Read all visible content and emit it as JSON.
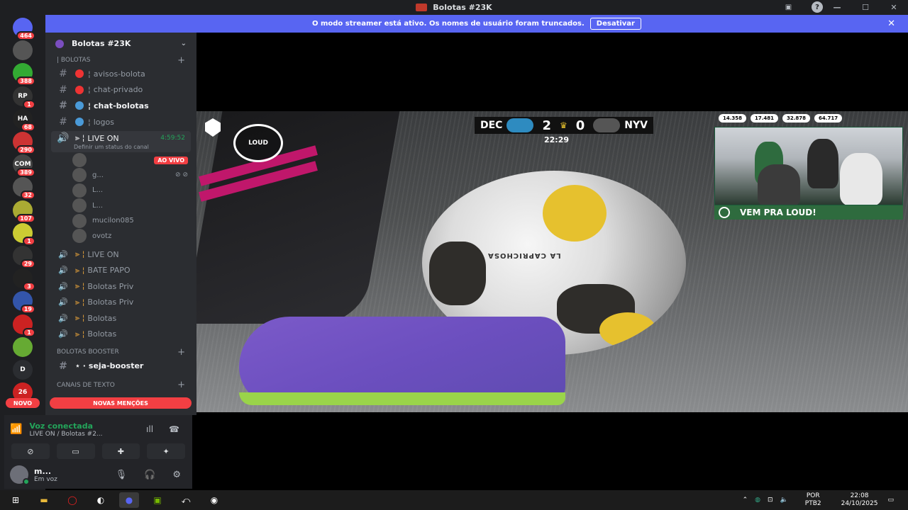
{
  "window": {
    "title": "Bolotas #23K",
    "controls": [
      "—",
      "☐",
      "✕"
    ]
  },
  "streamer_banner": {
    "text": "O modo streamer está ativo. Os nomes de usuário foram truncados.",
    "button": "Desativar"
  },
  "guilds": [
    {
      "label": "",
      "badge": "464",
      "color": "#5865f2"
    },
    {
      "label": "",
      "badge": "",
      "color": "#555"
    },
    {
      "label": "",
      "badge": "388",
      "color": "#3a3"
    },
    {
      "label": "RP",
      "badge": "1",
      "color": "#333"
    },
    {
      "label": "HA",
      "badge": "68",
      "color": "#222"
    },
    {
      "label": "",
      "badge": "290",
      "color": "#c33"
    },
    {
      "label": "COM",
      "badge": "389",
      "color": "#444"
    },
    {
      "label": "",
      "badge": "32",
      "color": "#555"
    },
    {
      "label": "",
      "badge": "107",
      "color": "#aa3"
    },
    {
      "label": "",
      "badge": "1",
      "color": "#cc3"
    },
    {
      "label": "",
      "badge": "29",
      "color": "#333"
    },
    {
      "label": "",
      "badge": "3",
      "color": "#222"
    },
    {
      "label": "",
      "badge": "19",
      "color": "#35a"
    },
    {
      "label": "",
      "badge": "1",
      "color": "#c22"
    },
    {
      "label": "",
      "badge": "",
      "color": "#6a3"
    },
    {
      "label": "D",
      "badge": "",
      "color": "#2b2d31"
    },
    {
      "label": "26",
      "badge": "",
      "color": "#c22"
    }
  ],
  "novo_label": "NOVO",
  "server": {
    "name": "Bolotas #23K"
  },
  "categories": {
    "bolotas": "| BOLOTAS",
    "booster": "Bolotas Booster",
    "texto": "Canais de Texto"
  },
  "text_channels": [
    {
      "name": "avisos-bolota",
      "emo_color": "#e33"
    },
    {
      "name": "chat-privado",
      "emo_color": "#e33"
    },
    {
      "name": "chat-bolotas",
      "emo_color": "#4a9ad8",
      "active": true
    },
    {
      "name": "logos",
      "emo_color": "#4a9ad8"
    }
  ],
  "live_channel": {
    "name": "LIVE ON",
    "timer": "4:59:52",
    "status": "Definir um status do canal"
  },
  "voice_users": [
    {
      "name": "",
      "tag": "AO VIVO"
    },
    {
      "name": "g...",
      "tag": ""
    },
    {
      "name": "L...",
      "tag": ""
    },
    {
      "name": "L...",
      "tag": ""
    },
    {
      "name": "mucilon085",
      "tag": ""
    },
    {
      "name": "ovotz",
      "tag": ""
    }
  ],
  "voice_channels": [
    {
      "name": "LIVE ON"
    },
    {
      "name": "BATE PAPO"
    },
    {
      "name": "Bolotas Priv"
    },
    {
      "name": "Bolotas Priv"
    },
    {
      "name": "Bolotas"
    },
    {
      "name": "Bolotas"
    }
  ],
  "booster_channel": {
    "name": "seja-booster"
  },
  "novas_mencoes": "NOVAS MENÇÕES",
  "voice_panel": {
    "status": "Voz conectada",
    "location": "LIVE ON / Bolotas #2..."
  },
  "user": {
    "name": "m...",
    "status": "Em voz"
  },
  "stream": {
    "team_left": "DEC",
    "score_left": "2",
    "score_right": "0",
    "team_right": "NYV",
    "clock": "22:29",
    "logo_text": "LOUD",
    "ball_text": "LA CAPRICHOSA",
    "stats": [
      "14.358",
      "17.481",
      "32.878",
      "64.717"
    ],
    "banner": "VEM PRA LOUD!"
  },
  "tray": {
    "lang1": "POR",
    "lang2": "PTB2",
    "time": "22:08",
    "date": "24/10/2025"
  }
}
